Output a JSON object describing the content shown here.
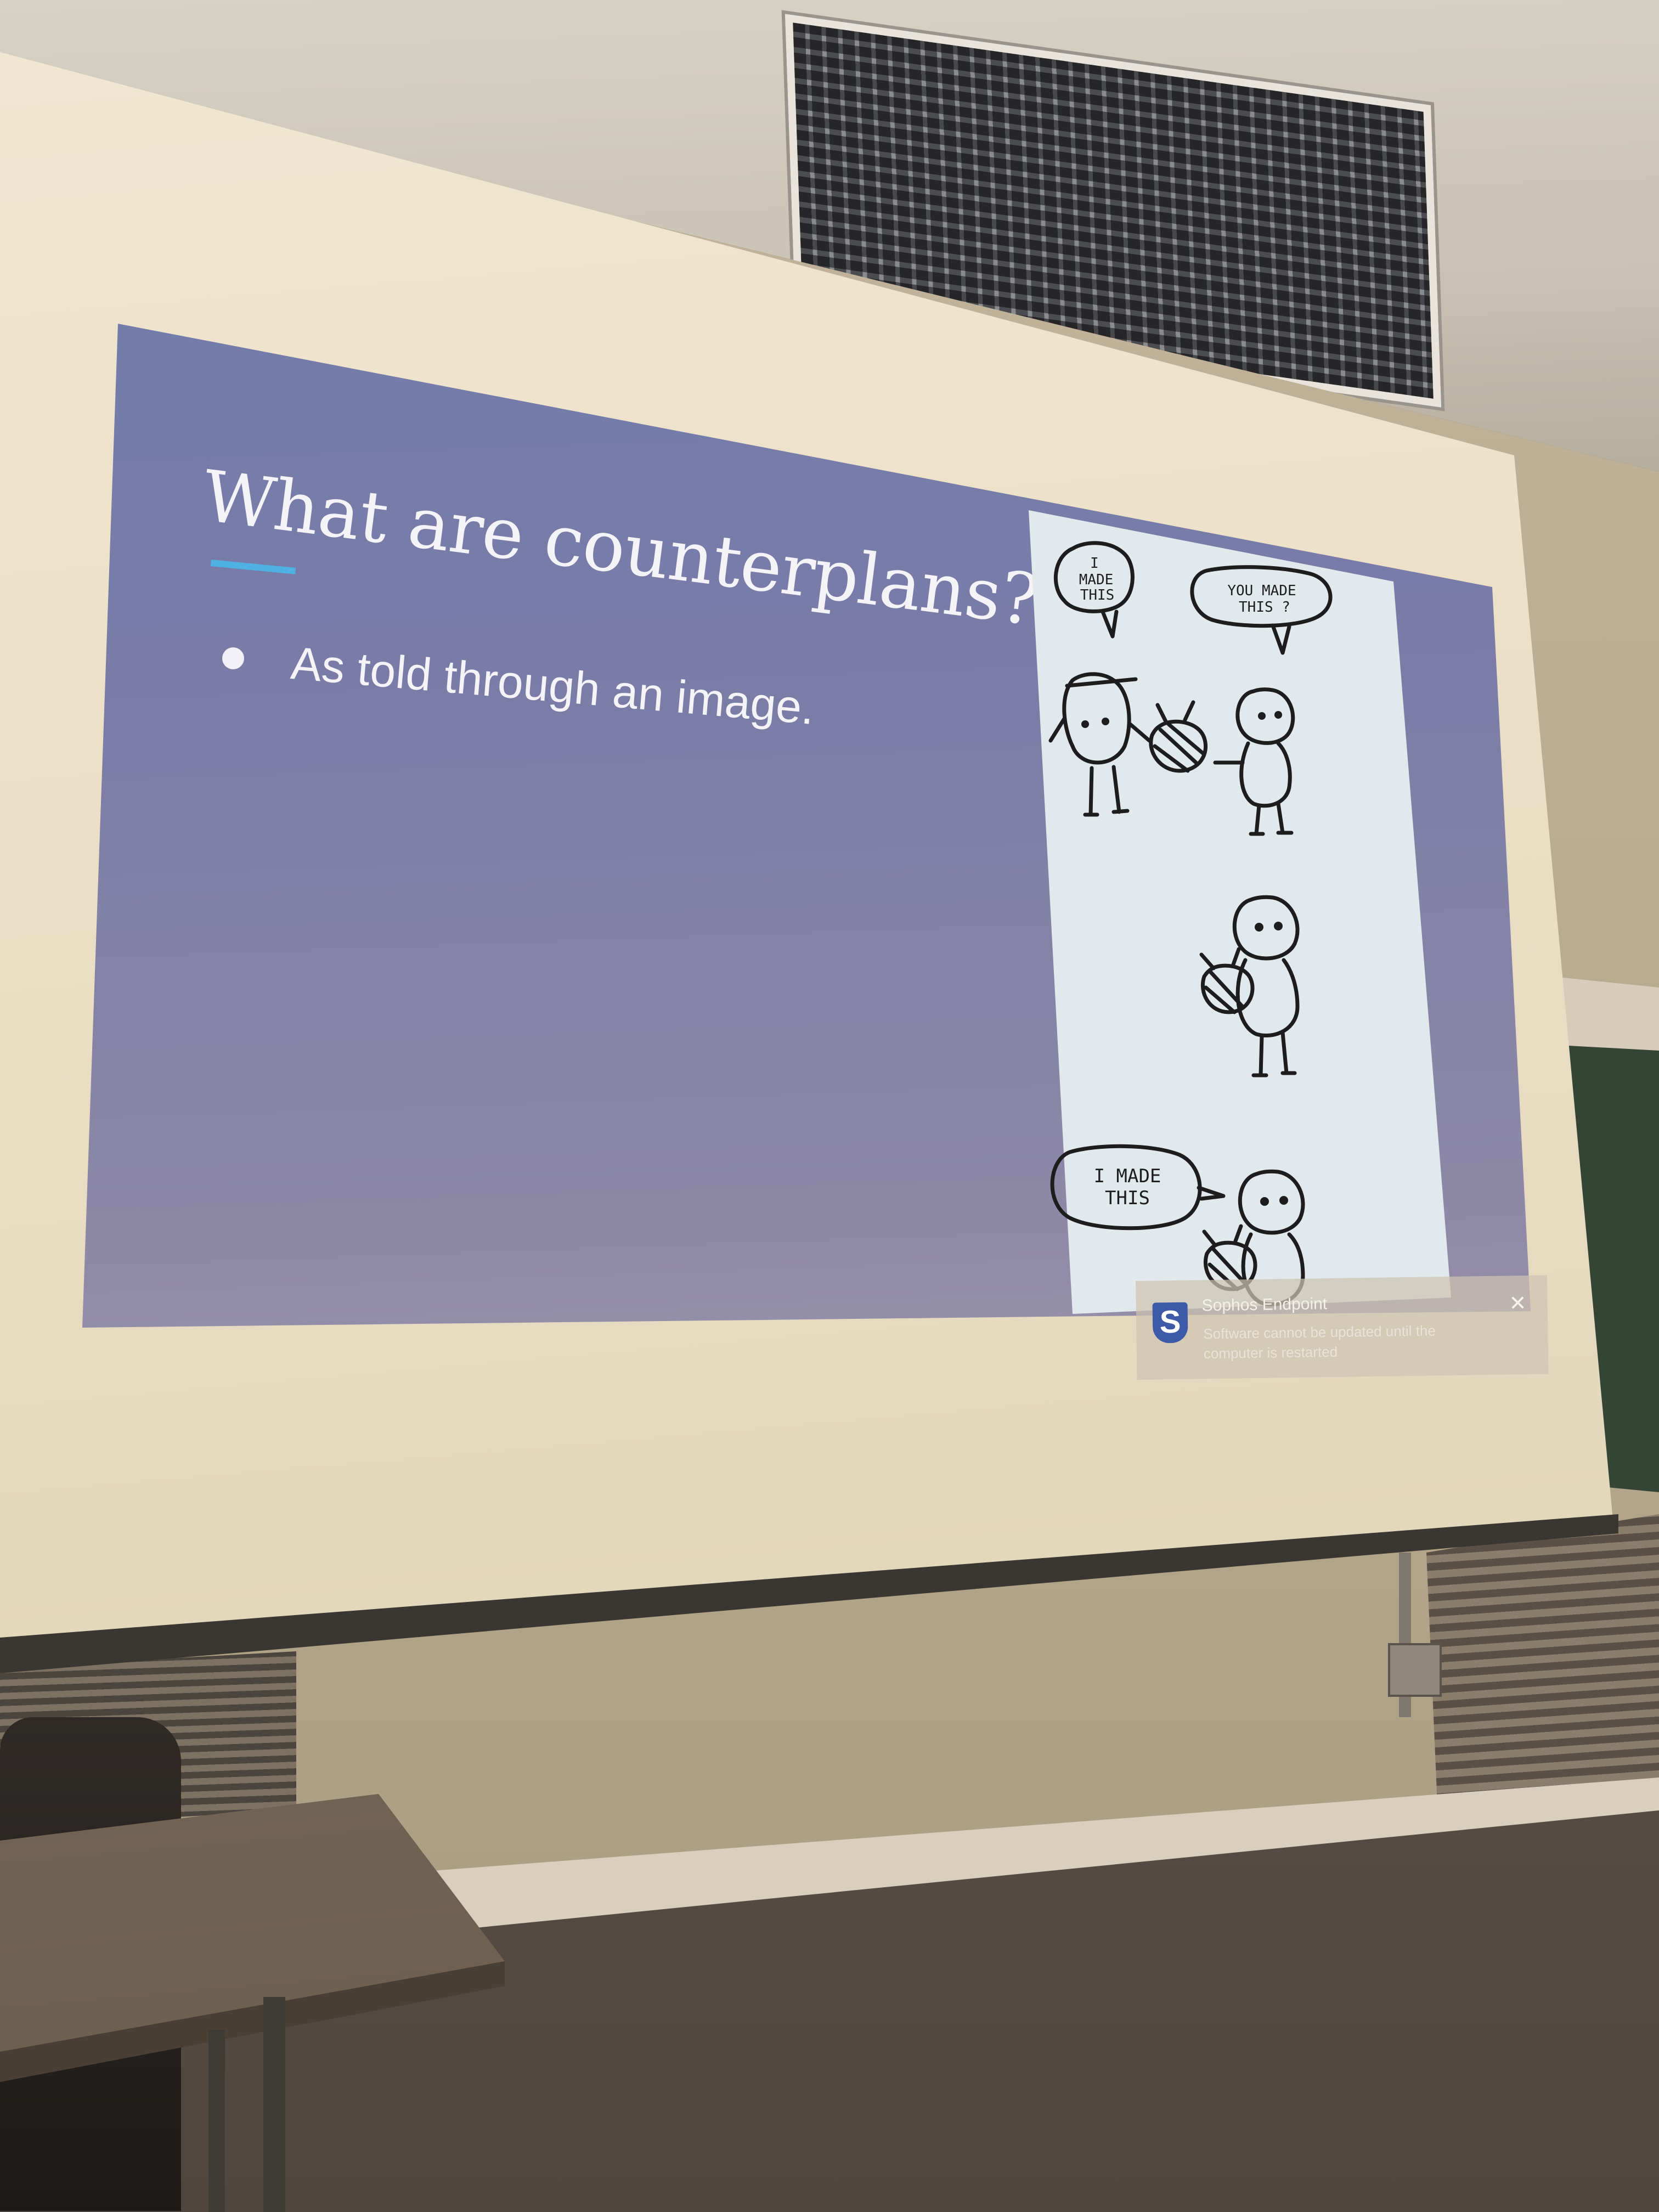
{
  "slide": {
    "title": "What are counterplans?",
    "bullets": [
      {
        "text": "As told through an image."
      }
    ],
    "accent_color": "#4fb0e2"
  },
  "comic": {
    "panel1": {
      "bubble_left": [
        "I",
        "MADE",
        "THIS"
      ],
      "bubble_right": [
        "YOU MADE",
        "THIS ?"
      ]
    },
    "panel3": {
      "bubble": [
        "I MADE",
        "THIS"
      ]
    }
  },
  "notification": {
    "app": "Sophos Endpoint",
    "message": "Software cannot be updated until the computer is restarted",
    "logo_letter": "S",
    "logo_icon": "sophos-shield-icon",
    "close_icon": "close-icon",
    "close_glyph": "✕",
    "brand_color": "#3d5aa8"
  }
}
